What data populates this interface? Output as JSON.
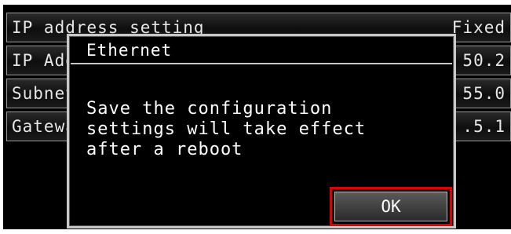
{
  "settings": {
    "rows": [
      {
        "label": "IP address setting",
        "value": "Fixed"
      },
      {
        "label": "IP Address",
        "value": "50.2"
      },
      {
        "label": "Subnet mask",
        "value": "55.0"
      },
      {
        "label": "Gateway",
        "value": ".5.1"
      }
    ]
  },
  "dialog": {
    "title": "Ethernet",
    "message": "Save the configuration\nsettings will take effect\nafter a reboot",
    "ok_label": "OK"
  },
  "colors": {
    "background": "#000000",
    "text": "#ffffff",
    "highlight": "#e00000"
  }
}
